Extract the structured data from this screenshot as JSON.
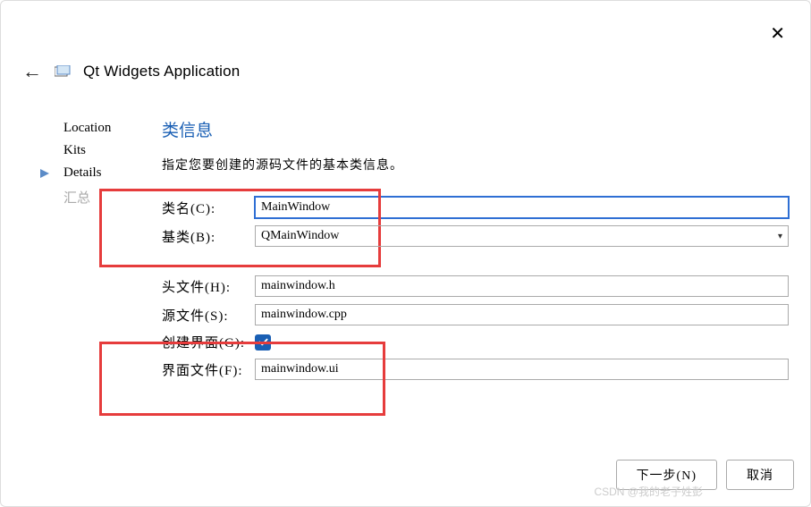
{
  "header": {
    "title": "Qt Widgets Application"
  },
  "sidebar": {
    "items": [
      {
        "label": "Location",
        "active": false
      },
      {
        "label": "Kits",
        "active": false
      },
      {
        "label": "Details",
        "active": true
      },
      {
        "label": "汇总",
        "active": false,
        "disabled": true
      }
    ]
  },
  "main": {
    "section_title": "类信息",
    "subtitle": "指定您要创建的源码文件的基本类信息。",
    "class_name_label": "类名(C):",
    "class_name_value": "MainWindow",
    "base_class_label": "基类(B):",
    "base_class_value": "QMainWindow",
    "header_file_label": "头文件(H):",
    "header_file_value": "mainwindow.h",
    "source_file_label": "源文件(S):",
    "source_file_value": "mainwindow.cpp",
    "create_ui_label": "创建界面(G):",
    "create_ui_checked": true,
    "ui_file_label": "界面文件(F):",
    "ui_file_value": "mainwindow.ui"
  },
  "footer": {
    "next_label": "下一步(N)",
    "cancel_label": "取消"
  },
  "watermark": "CSDN @我的老子姓彭"
}
